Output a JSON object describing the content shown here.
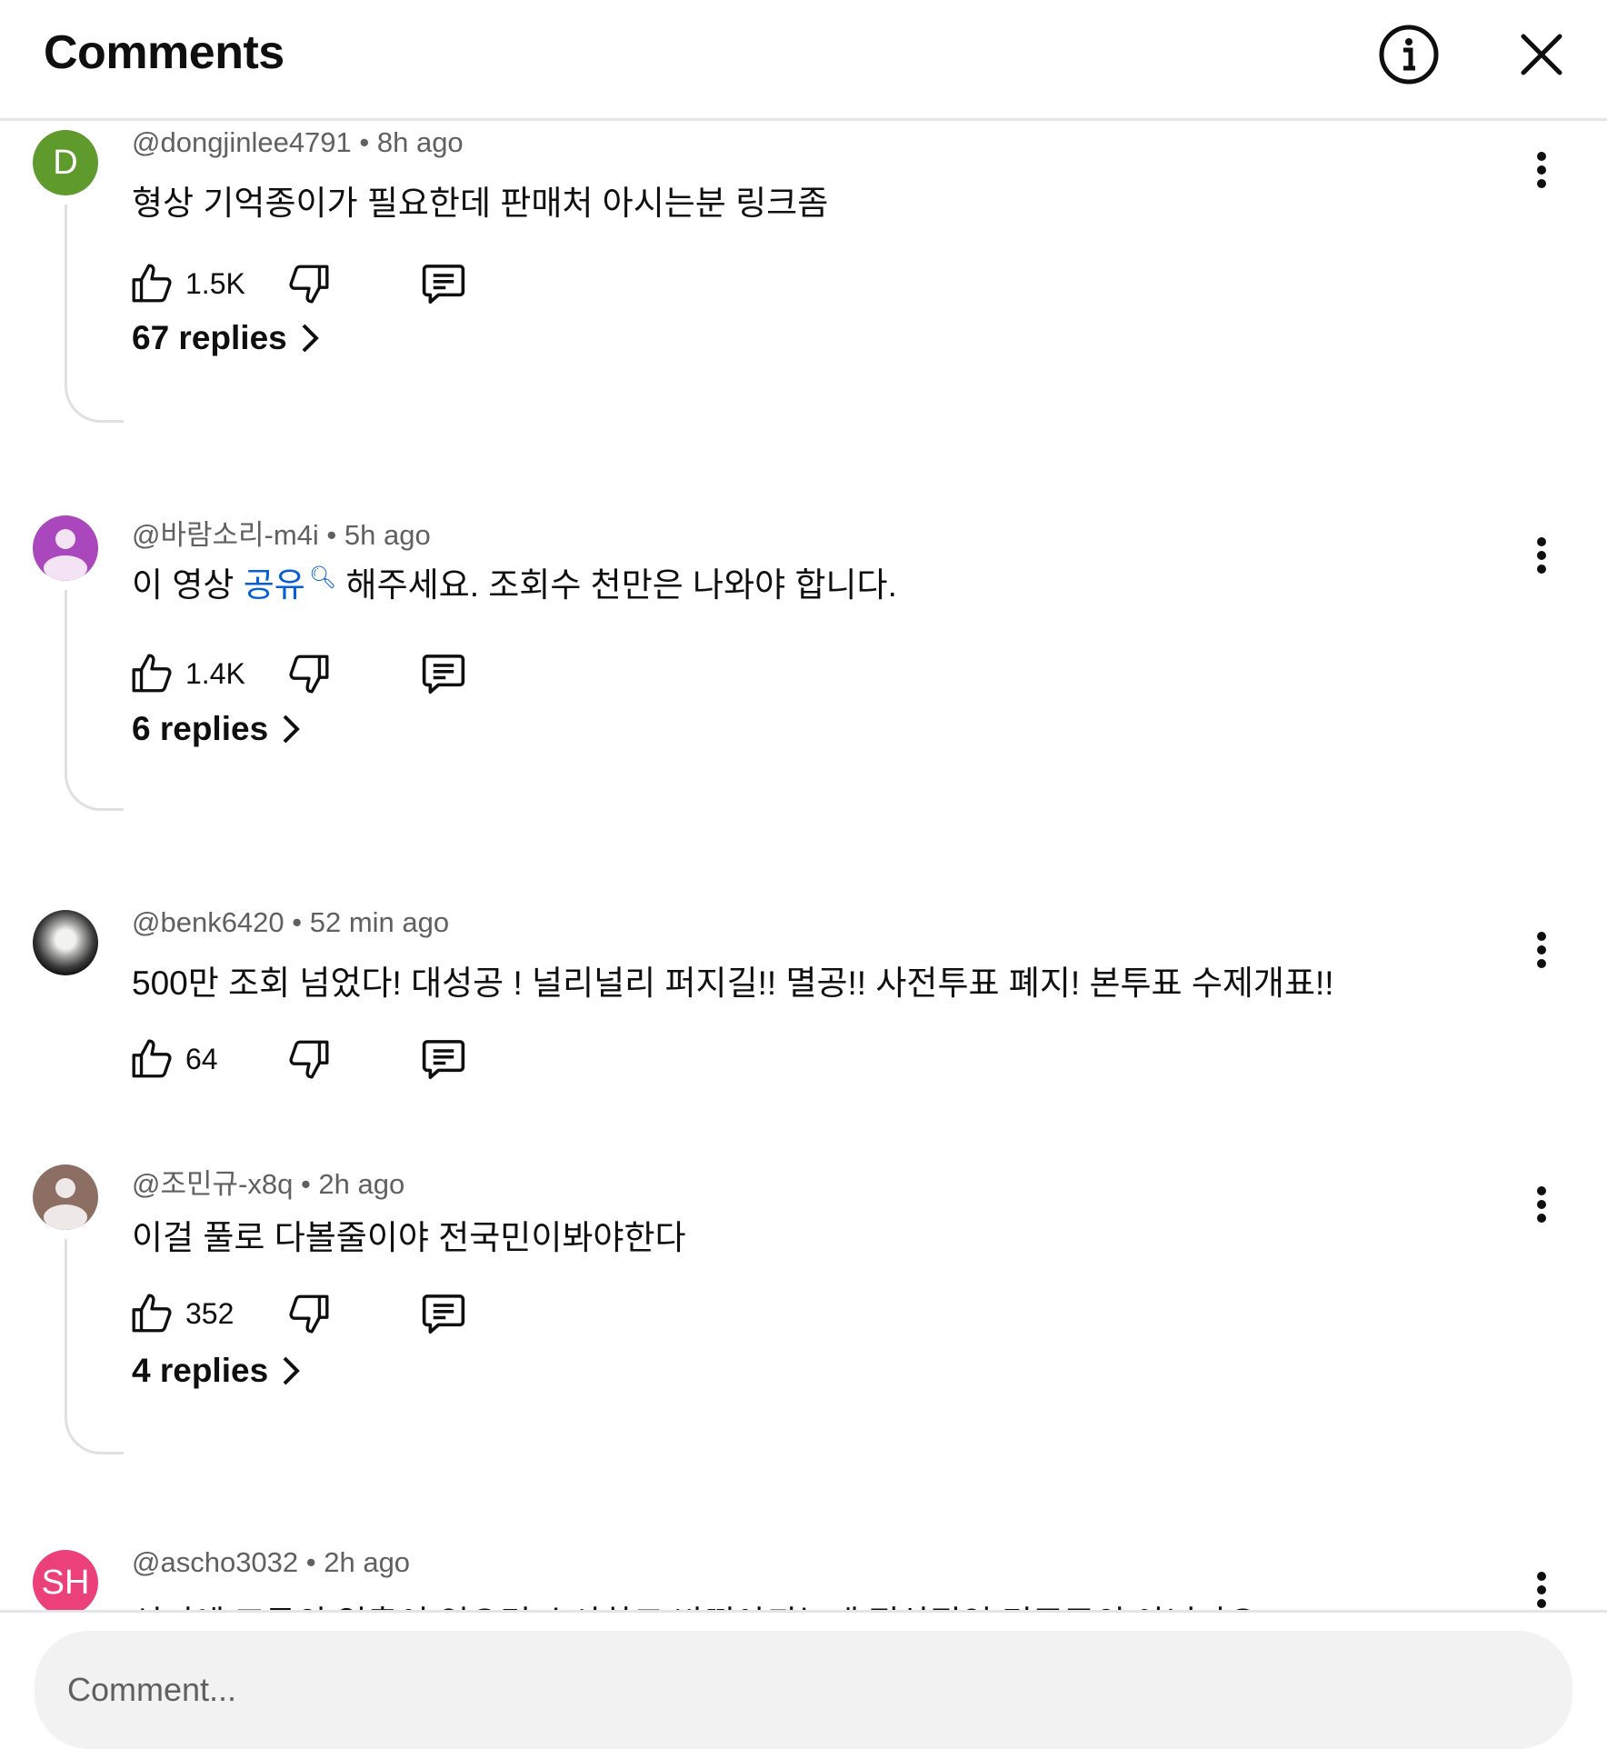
{
  "header": {
    "title": "Comments",
    "info_icon": "info-icon",
    "close_icon": "close-icon"
  },
  "comments": [
    {
      "author": "@dongjinlee4791",
      "time": "8h ago",
      "meta": "@dongjinlee4791 • 8h ago",
      "avatar_letter": "D",
      "avatar_color": "#5f9a2d",
      "text": "형상 기억종이가 필요한데 판매처 아시는분 링크좀",
      "likes": "1.5K",
      "replies": "67 replies"
    },
    {
      "author": "@바람소리-m4i",
      "time": "5h ago",
      "meta": "@바람소리-m4i • 5h ago",
      "avatar_color": "#ab47bc",
      "text_before": "이 영상 ",
      "text_link": "공유",
      "text_after": " 해주세요. 조회수 천만은 나와야 합니다.",
      "likes": "1.4K",
      "replies": "6 replies"
    },
    {
      "author": "@benk6420",
      "time": "52 min ago",
      "meta": "@benk6420 • 52 min ago",
      "text": "500만 조회 넘었다! 대성공 ! 널리널리 퍼지길!! 멸공!! 사전투표 폐지! 본투표 수제개표!!",
      "likes": "64"
    },
    {
      "author": "@조민규-x8q",
      "time": "2h ago",
      "meta": "@조민규-x8q • 2h ago",
      "avatar_color": "#8d6e63",
      "text": "이걸 풀로 다볼줄이야 전국민이봐야한다",
      "likes": "352",
      "replies": "4 replies"
    },
    {
      "author": "@ascho3032",
      "time": "2h ago",
      "meta": "@ascho3032 • 2h ago",
      "avatar_letter": "SH",
      "avatar_color": "#ec407a",
      "text": "선거에 조국의 입출이 있으면 수사하고 바꿔야되는게 정상적인 민주주의 아닌가요"
    }
  ],
  "footer": {
    "placeholder": "Comment..."
  }
}
